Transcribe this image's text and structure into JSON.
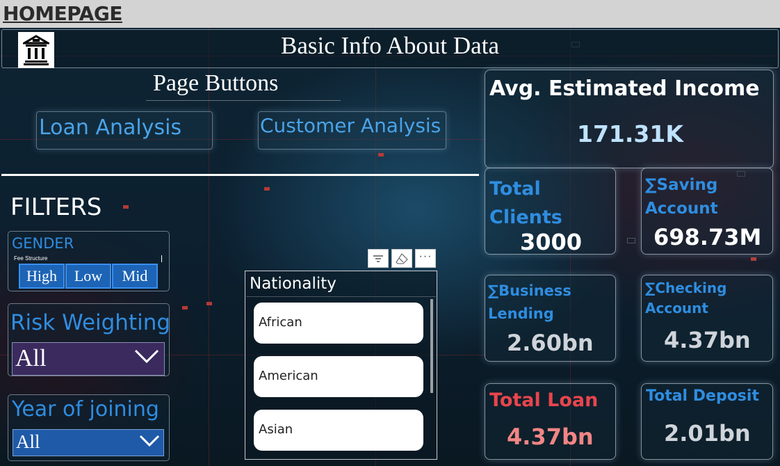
{
  "topbar": {
    "title": "HOMEPAGE"
  },
  "banner": {
    "title": "Basic Info About Data",
    "logo_icon": "bank-building-icon"
  },
  "page_buttons": {
    "title": "Page Buttons",
    "loan_analysis": "Loan Analysis",
    "customer_analysis": "Customer Analysis"
  },
  "filters": {
    "title": "FILTERS",
    "gender": {
      "label": "GENDER",
      "sublabel": "Fee Structure",
      "options": [
        "High",
        "Low",
        "Mid"
      ]
    },
    "risk_weighting": {
      "label": "Risk Weighting",
      "selected": "All"
    },
    "year_of_joining": {
      "label": "Year of joining",
      "selected": "All"
    }
  },
  "nationality": {
    "title": "Nationality",
    "items": [
      "African",
      "American",
      "Asian"
    ],
    "tools": {
      "filter_icon": "filter-icon",
      "eraser_icon": "eraser-icon",
      "more_icon": "more-options-icon"
    }
  },
  "kpis": {
    "avg_income": {
      "label": "Avg. Estimated Income",
      "value": "171.31K"
    },
    "total_clients": {
      "label": "Total Clients",
      "value": "3000"
    },
    "saving_account": {
      "label": "∑Saving Account",
      "value": "698.73M"
    },
    "business_lending": {
      "label": "∑Business Lending",
      "value": "2.60bn"
    },
    "checking_account": {
      "label": "∑Checking Account",
      "value": "4.37bn"
    },
    "total_loan": {
      "label": "Total Loan",
      "value": "4.37bn"
    },
    "total_deposit": {
      "label": "Total Deposit",
      "value": "2.01bn"
    }
  },
  "colors": {
    "accent_blue": "#2f8de0",
    "loan_red": "#e8454d",
    "background": "#0b1a27"
  }
}
